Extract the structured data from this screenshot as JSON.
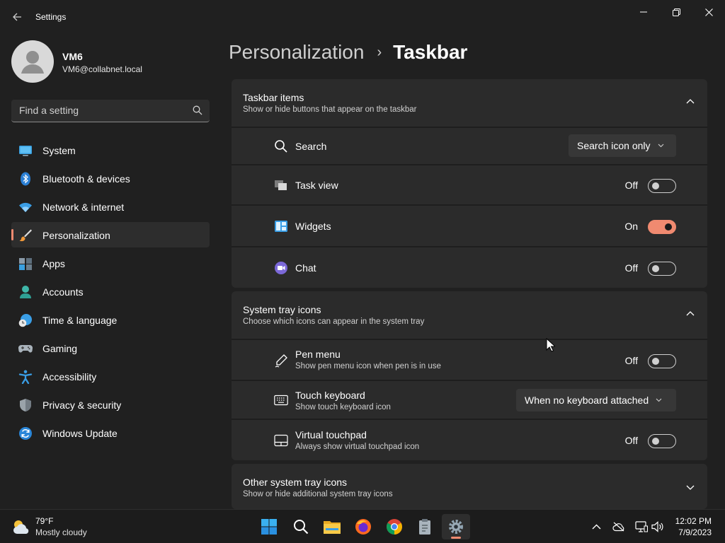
{
  "window": {
    "title": "Settings",
    "back_icon": "arrow-left-icon",
    "controls": [
      "minimize-icon",
      "restore-icon",
      "close-icon"
    ]
  },
  "profile": {
    "name": "VM6",
    "email": "VM6@collabnet.local"
  },
  "search": {
    "placeholder": "Find a setting",
    "value": ""
  },
  "nav": {
    "active": "Personalization",
    "items": [
      {
        "label": "System",
        "icon": "monitor-icon"
      },
      {
        "label": "Bluetooth & devices",
        "icon": "bluetooth-icon"
      },
      {
        "label": "Network & internet",
        "icon": "wifi-icon"
      },
      {
        "label": "Personalization",
        "icon": "paintbrush-icon"
      },
      {
        "label": "Apps",
        "icon": "apps-icon"
      },
      {
        "label": "Accounts",
        "icon": "person-icon"
      },
      {
        "label": "Time & language",
        "icon": "clock-globe-icon"
      },
      {
        "label": "Gaming",
        "icon": "gamepad-icon"
      },
      {
        "label": "Accessibility",
        "icon": "accessibility-icon"
      },
      {
        "label": "Privacy & security",
        "icon": "shield-icon"
      },
      {
        "label": "Windows Update",
        "icon": "sync-icon"
      }
    ]
  },
  "breadcrumb": {
    "parent": "Personalization",
    "separator": "›",
    "current": "Taskbar"
  },
  "taskbar_items": {
    "title": "Taskbar items",
    "subtitle": "Show or hide buttons that appear on the taskbar",
    "expanded": true,
    "search": {
      "label": "Search",
      "value": "Search icon only"
    },
    "task_view": {
      "label": "Task view",
      "state": "Off"
    },
    "widgets": {
      "label": "Widgets",
      "state": "On"
    },
    "chat": {
      "label": "Chat",
      "state": "Off"
    }
  },
  "system_tray": {
    "title": "System tray icons",
    "subtitle": "Choose which icons can appear in the system tray",
    "expanded": true,
    "pen_menu": {
      "label": "Pen menu",
      "description": "Show pen menu icon when pen is in use",
      "state": "Off"
    },
    "touch_keyboard": {
      "label": "Touch keyboard",
      "description": "Show touch keyboard icon",
      "value": "When no keyboard attached"
    },
    "virtual_touchpad": {
      "label": "Virtual touchpad",
      "description": "Always show virtual touchpad icon",
      "state": "Off"
    }
  },
  "other_tray": {
    "title": "Other system tray icons",
    "subtitle": "Show or hide additional system tray icons",
    "expanded": false
  },
  "os_taskbar": {
    "weather": {
      "temp": "79°F",
      "condition": "Mostly cloudy"
    },
    "apps": [
      "windows-start-icon",
      "search-icon",
      "file-explorer-icon",
      "firefox-icon",
      "chrome-icon",
      "clipboard-app-icon",
      "settings-gear-icon"
    ],
    "active_app": "settings-gear-icon",
    "tray": [
      "chevron-up-icon",
      "cloud-off-icon",
      "network-icon",
      "volume-icon"
    ],
    "time": "12:02 PM",
    "date": "7/9/2023"
  },
  "colors": {
    "accent": "#f08a70",
    "background": "#202020",
    "card": "#2b2b2b"
  }
}
